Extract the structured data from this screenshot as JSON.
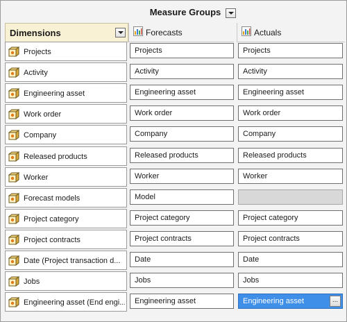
{
  "header": {
    "measure_groups_label": "Measure Groups",
    "dimensions_label": "Dimensions",
    "columns": [
      {
        "label": "Forecasts",
        "icon": "bar-chart-icon"
      },
      {
        "label": "Actuals",
        "icon": "bar-chart-icon"
      }
    ]
  },
  "rows": [
    {
      "dimension": "Projects",
      "forecasts": "Projects",
      "actuals": "Projects"
    },
    {
      "dimension": "Activity",
      "forecasts": "Activity",
      "actuals": "Activity"
    },
    {
      "dimension": "Engineering asset",
      "forecasts": "Engineering asset",
      "actuals": "Engineering asset"
    },
    {
      "dimension": "Work order",
      "forecasts": "Work order",
      "actuals": "Work order"
    },
    {
      "dimension": "Company",
      "forecasts": "Company",
      "actuals": "Company"
    },
    {
      "dimension": "Released products",
      "forecasts": "Released products",
      "actuals": "Released products"
    },
    {
      "dimension": "Worker",
      "forecasts": "Worker",
      "actuals": "Worker"
    },
    {
      "dimension": "Forecast models",
      "forecasts": "Model",
      "actuals": ""
    },
    {
      "dimension": "Project category",
      "forecasts": "Project category",
      "actuals": "Project category"
    },
    {
      "dimension": "Project contracts",
      "forecasts": "Project contracts",
      "actuals": "Project contracts"
    },
    {
      "dimension": "Date (Project transaction d...",
      "forecasts": "Date",
      "actuals": "Date"
    },
    {
      "dimension": "Jobs",
      "forecasts": "Jobs",
      "actuals": "Jobs"
    },
    {
      "dimension": "Engineering asset (End engi...",
      "forecasts": "Engineering asset",
      "actuals": "Engineering asset"
    }
  ],
  "ellipsis_label": "...",
  "colors": {
    "selection": "#3f8fe8",
    "dimension_header_bg": "#f8f1d4",
    "empty_cell": "#d8d8d8"
  }
}
